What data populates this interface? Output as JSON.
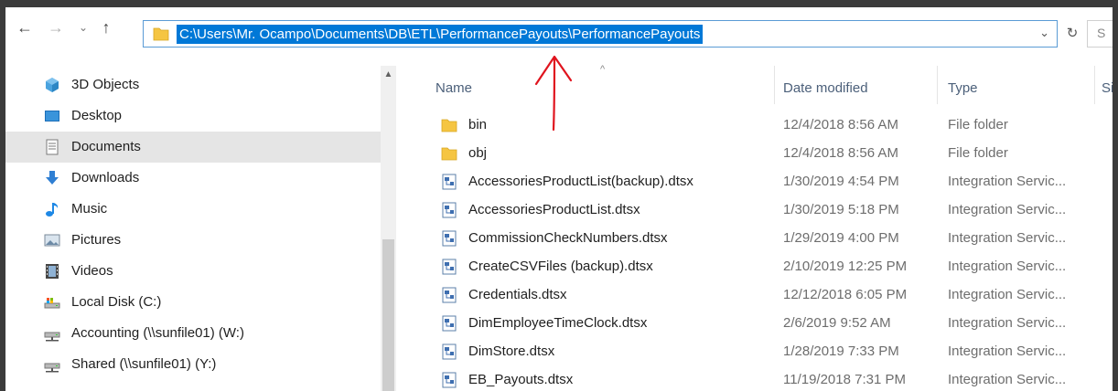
{
  "address_bar": {
    "path": "C:\\Users\\Mr. Ocampo\\Documents\\DB\\ETL\\PerformancePayouts\\PerformancePayouts",
    "dropdown_icon": "chevron-down-icon",
    "search_partial": "S"
  },
  "nav_buttons": {
    "back": "←",
    "forward": "→",
    "recent": "⌄",
    "up": "↑",
    "refresh": "↻",
    "dropdown": "⌄"
  },
  "nav_pane": {
    "items": [
      {
        "label": "3D Objects",
        "icon": "cube-3d-icon"
      },
      {
        "label": "Desktop",
        "icon": "desktop-icon"
      },
      {
        "label": "Documents",
        "icon": "documents-icon",
        "selected": true
      },
      {
        "label": "Downloads",
        "icon": "download-arrow-icon"
      },
      {
        "label": "Music",
        "icon": "music-note-icon"
      },
      {
        "label": "Pictures",
        "icon": "pictures-icon"
      },
      {
        "label": "Videos",
        "icon": "video-film-icon"
      },
      {
        "label": "Local Disk (C:)",
        "icon": "local-disk-icon"
      },
      {
        "label": "Accounting (\\\\sunfile01) (W:)",
        "icon": "network-drive-icon"
      },
      {
        "label": "Shared (\\\\sunfile01) (Y:)",
        "icon": "network-drive-icon"
      }
    ],
    "scroll_up": "▲"
  },
  "file_list": {
    "columns": {
      "name": "Name",
      "date_modified": "Date modified",
      "type": "Type",
      "size_partial": "Si"
    },
    "sort_indicator": "^",
    "rows": [
      {
        "name": "bin",
        "date": "12/4/2018 8:56 AM",
        "type": "File folder",
        "icon": "folder-icon"
      },
      {
        "name": "obj",
        "date": "12/4/2018 8:56 AM",
        "type": "File folder",
        "icon": "folder-icon"
      },
      {
        "name": "AccessoriesProductList(backup).dtsx",
        "date": "1/30/2019 4:54 PM",
        "type": "Integration Servic...",
        "icon": "dtsx-file-icon"
      },
      {
        "name": "AccessoriesProductList.dtsx",
        "date": "1/30/2019 5:18 PM",
        "type": "Integration Servic...",
        "icon": "dtsx-file-icon"
      },
      {
        "name": "CommissionCheckNumbers.dtsx",
        "date": "1/29/2019 4:00 PM",
        "type": "Integration Servic...",
        "icon": "dtsx-file-icon"
      },
      {
        "name": "CreateCSVFiles (backup).dtsx",
        "date": "2/10/2019 12:25 PM",
        "type": "Integration Servic...",
        "icon": "dtsx-file-icon"
      },
      {
        "name": "Credentials.dtsx",
        "date": "12/12/2018 6:05 PM",
        "type": "Integration Servic...",
        "icon": "dtsx-file-icon"
      },
      {
        "name": "DimEmployeeTimeClock.dtsx",
        "date": "2/6/2019 9:52 AM",
        "type": "Integration Servic...",
        "icon": "dtsx-file-icon"
      },
      {
        "name": "DimStore.dtsx",
        "date": "1/28/2019 7:33 PM",
        "type": "Integration Servic...",
        "icon": "dtsx-file-icon"
      },
      {
        "name": "EB_Payouts.dtsx",
        "date": "11/19/2018 7:31 PM",
        "type": "Integration Servic...",
        "icon": "dtsx-file-icon"
      }
    ]
  },
  "colors": {
    "selection_blue": "#0078d7",
    "address_border": "#5a9bd5",
    "annotation_red": "#e0141e",
    "folder_yellow": "#f5c542"
  }
}
